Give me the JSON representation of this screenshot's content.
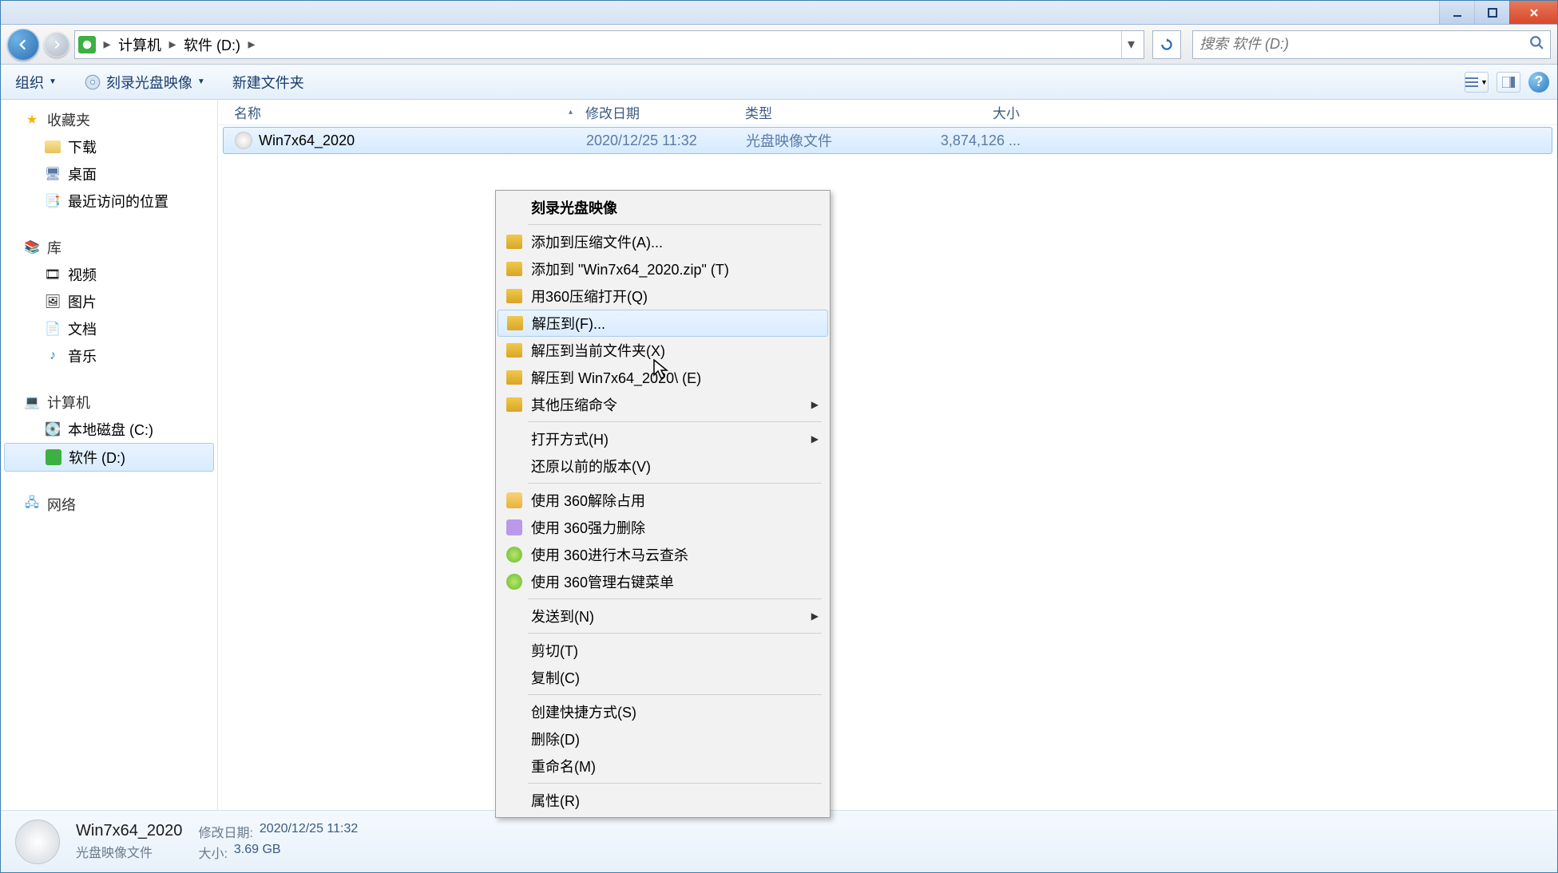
{
  "titlebar": {},
  "nav": {
    "breadcrumb": {
      "seg1": "计算机",
      "seg2": "软件 (D:)"
    },
    "search_placeholder": "搜索 软件 (D:)"
  },
  "toolbar": {
    "organize": "组织",
    "burn": "刻录光盘映像",
    "newfolder": "新建文件夹"
  },
  "sidebar": {
    "favorites": "收藏夹",
    "downloads": "下载",
    "desktop": "桌面",
    "recent": "最近访问的位置",
    "libraries": "库",
    "videos": "视频",
    "pictures": "图片",
    "documents": "文档",
    "music": "音乐",
    "computer": "计算机",
    "drive_c": "本地磁盘 (C:)",
    "drive_d": "软件 (D:)",
    "network": "网络"
  },
  "columns": {
    "name": "名称",
    "date": "修改日期",
    "type": "类型",
    "size": "大小"
  },
  "files": [
    {
      "name": "Win7x64_2020",
      "date": "2020/12/25 11:32",
      "type": "光盘映像文件",
      "size": "3,874,126 ..."
    }
  ],
  "context_menu": {
    "burn": "刻录光盘映像",
    "add_archive": "添加到压缩文件(A)...",
    "add_zip": "添加到 \"Win7x64_2020.zip\" (T)",
    "open_360zip": "用360压缩打开(Q)",
    "extract_to": "解压到(F)...",
    "extract_here": "解压到当前文件夹(X)",
    "extract_folder": "解压到 Win7x64_2020\\ (E)",
    "other_zip": "其他压缩命令",
    "open_with": "打开方式(H)",
    "restore_prev": "还原以前的版本(V)",
    "unlock_360": "使用 360解除占用",
    "force_del_360": "使用 360强力删除",
    "scan_360": "使用 360进行木马云查杀",
    "manage_360": "使用 360管理右键菜单",
    "send_to": "发送到(N)",
    "cut": "剪切(T)",
    "copy": "复制(C)",
    "create_shortcut": "创建快捷方式(S)",
    "delete": "删除(D)",
    "rename": "重命名(M)",
    "properties": "属性(R)"
  },
  "details": {
    "filename": "Win7x64_2020",
    "filetype": "光盘映像文件",
    "date_label": "修改日期:",
    "date_val": "2020/12/25 11:32",
    "size_label": "大小:",
    "size_val": "3.69 GB"
  }
}
